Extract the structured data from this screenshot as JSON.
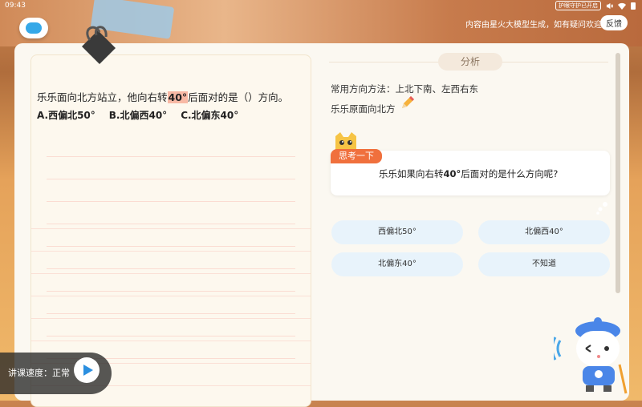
{
  "status": {
    "time": "09:43",
    "eye_mode": "护眼守护已开启"
  },
  "header": {
    "disclaimer": "内容由星火大模型生成，如有疑问欢迎",
    "feedback_label": "反馈"
  },
  "question": {
    "text_before": "乐乐面向北方站立，他向右转",
    "highlight": "40°",
    "text_after": "后面对的是（）方向。",
    "options": [
      "A.西偏北50°",
      "B.北偏西40°",
      "C.北偏东40°"
    ]
  },
  "player": {
    "speed_label": "讲课速度：正常"
  },
  "analysis": {
    "tab_label": "分析",
    "method": "常用方向方法：上北下南、左西右东",
    "facing": "乐乐原面向北方",
    "think_tag": "思考一下",
    "think_before": "乐乐如果向右转",
    "think_bold": "40°",
    "think_after": "后面对的是什么方向呢?",
    "choices": [
      "西偏北50°",
      "北偏西40°",
      "北偏东40°",
      "不知道"
    ]
  }
}
